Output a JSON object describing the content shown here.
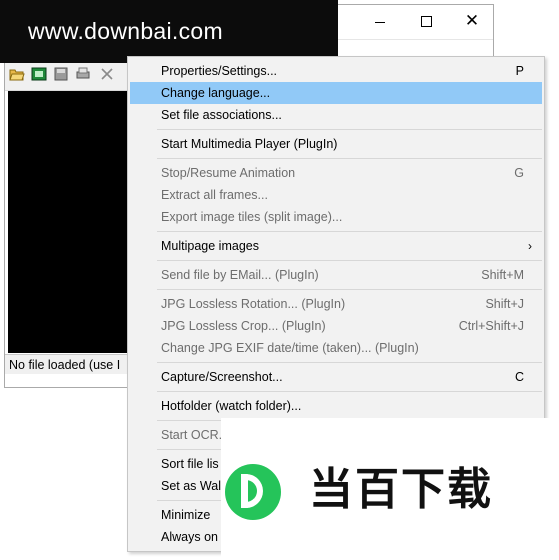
{
  "window": {
    "status_text": "No file loaded (use I"
  },
  "watermarks": {
    "top": "www.downbai.com",
    "bottom": "当百下载"
  },
  "menu": {
    "items": [
      {
        "label": "Properties/Settings...",
        "shortcut": "P",
        "disabled": false
      },
      {
        "label": "Change language...",
        "shortcut": "",
        "disabled": false,
        "highlight": true
      },
      {
        "label": "Set file associations...",
        "shortcut": "",
        "disabled": false
      },
      {
        "label": "Start Multimedia Player (PlugIn)",
        "shortcut": "",
        "disabled": false
      },
      {
        "label": "Stop/Resume Animation",
        "shortcut": "G",
        "disabled": true
      },
      {
        "label": "Extract all frames...",
        "shortcut": "",
        "disabled": true
      },
      {
        "label": "Export image tiles (split image)...",
        "shortcut": "",
        "disabled": true
      },
      {
        "label": "Multipage images",
        "shortcut": "",
        "disabled": false,
        "submenu": true
      },
      {
        "label": "Send file by EMail... (PlugIn)",
        "shortcut": "Shift+M",
        "disabled": true
      },
      {
        "label": "JPG Lossless Rotation... (PlugIn)",
        "shortcut": "Shift+J",
        "disabled": true
      },
      {
        "label": "JPG Lossless Crop... (PlugIn)",
        "shortcut": "Ctrl+Shift+J",
        "disabled": true
      },
      {
        "label": "Change JPG EXIF date/time (taken)... (PlugIn)",
        "shortcut": "",
        "disabled": true
      },
      {
        "label": "Capture/Screenshot...",
        "shortcut": "C",
        "disabled": false
      },
      {
        "label": "Hotfolder (watch folder)...",
        "shortcut": "",
        "disabled": false
      },
      {
        "label": "Start OCR...",
        "shortcut": "",
        "disabled": true
      },
      {
        "label": "Sort file lis",
        "shortcut": "",
        "disabled": false
      },
      {
        "label": "Set as Wal",
        "shortcut": "",
        "disabled": false
      },
      {
        "label": "Minimize",
        "shortcut": "",
        "disabled": false
      },
      {
        "label": "Always on",
        "shortcut": "",
        "disabled": false
      }
    ]
  }
}
